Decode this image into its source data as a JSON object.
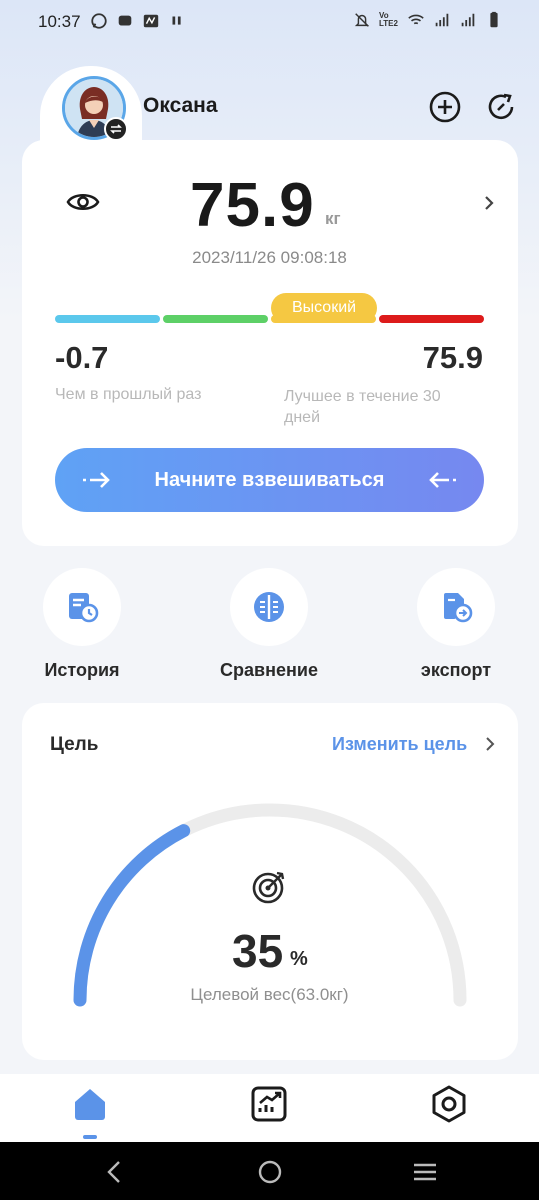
{
  "status_bar": {
    "time": "10:37",
    "left_icons": [
      "whatsapp-icon",
      "message-icon",
      "app-icon",
      "pause-icon"
    ],
    "right_icons": [
      "mute-icon",
      "volte-icon",
      "wifi-icon",
      "signal-icon",
      "signal-icon",
      "battery-icon"
    ],
    "volte_text": "Vo LTE2"
  },
  "header": {
    "user_name": "Оксана"
  },
  "weight_card": {
    "value": "75.9",
    "unit": "кг",
    "timestamp": "2023/11/26 09:08:18",
    "status_badge": "Высокий",
    "bar_colors": [
      "#5bc8ec",
      "#5dd067",
      "#f5c842",
      "#dd1b1b"
    ],
    "change_value": "-0.7",
    "change_label": "Чем в прошлый раз",
    "best_value": "75.9",
    "best_label": "Лучшее в течение 30 дней",
    "start_button": "Начните взвешиваться"
  },
  "shortcuts": [
    {
      "label": "История",
      "icon": "history-icon"
    },
    {
      "label": "Сравнение",
      "icon": "compare-icon"
    },
    {
      "label": "экспорт",
      "icon": "export-icon"
    }
  ],
  "goal": {
    "title": "Цель",
    "edit_label": "Изменить цель",
    "progress_percent": "35",
    "percent_sign": "%",
    "progress_fraction": 0.35,
    "target_label": "Целевой вес(63.0кг)"
  },
  "bottom_nav": {
    "items": [
      "home-icon",
      "trend-chart-icon",
      "settings-icon"
    ],
    "active": "home-icon"
  },
  "colors": {
    "accent": "#5b93e8",
    "gauge_track": "#ececec"
  }
}
